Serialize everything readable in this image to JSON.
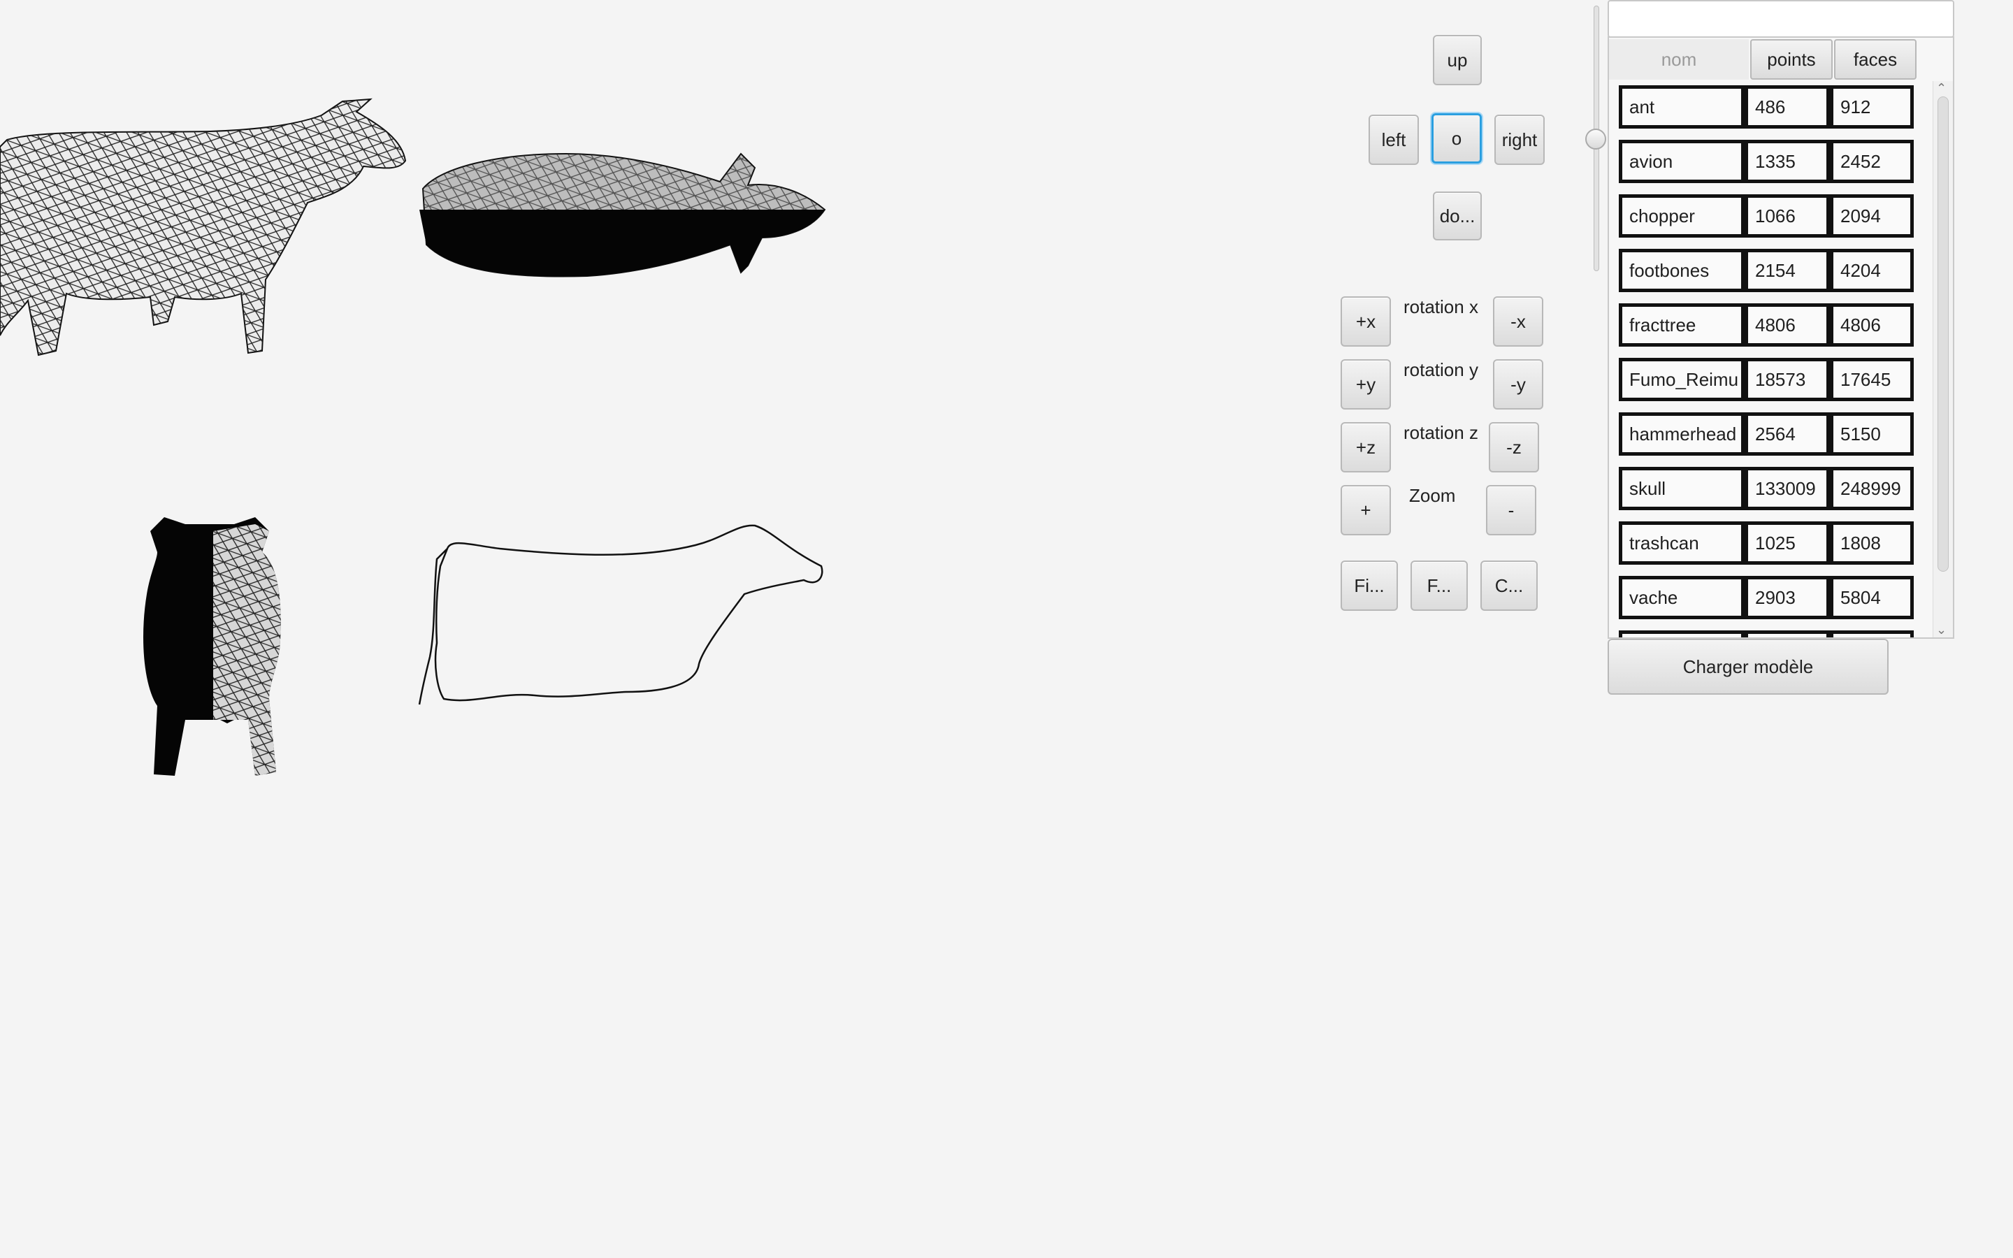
{
  "controls": {
    "up": "up",
    "left": "left",
    "center": "o",
    "right": "right",
    "down": "do...",
    "plus_x": "+x",
    "minus_x": "-x",
    "rot_x_label": "rotation x",
    "plus_y": "+y",
    "minus_y": "-y",
    "rot_y_label": "rotation y",
    "plus_z": "+z",
    "minus_z": "-z",
    "rot_z_label": "rotation z",
    "zoom_in": "+",
    "zoom_out": "-",
    "zoom_label": "Zoom",
    "btn_fi": "Fi...",
    "btn_f": "F...",
    "btn_c": "C..."
  },
  "search": {
    "value": ""
  },
  "table": {
    "headers": [
      "nom",
      "points",
      "faces"
    ],
    "rows": [
      [
        "ant",
        "486",
        "912"
      ],
      [
        "avion",
        "1335",
        "2452"
      ],
      [
        "chopper",
        "1066",
        "2094"
      ],
      [
        "footbones",
        "2154",
        "4204"
      ],
      [
        "fracttree",
        "4806",
        "4806"
      ],
      [
        "Fumo_Reimu",
        "18573",
        "17645"
      ],
      [
        "hammerhead",
        "2564",
        "5150"
      ],
      [
        "skull",
        "133009",
        "248999"
      ],
      [
        "trashcan",
        "1025",
        "1808"
      ],
      [
        "vache",
        "2903",
        "5804"
      ]
    ]
  },
  "load_button": "Charger modèle",
  "views": [
    "cow-side-wireframe",
    "cow-top-shaded",
    "cow-front-shaded",
    "cow-outline"
  ]
}
